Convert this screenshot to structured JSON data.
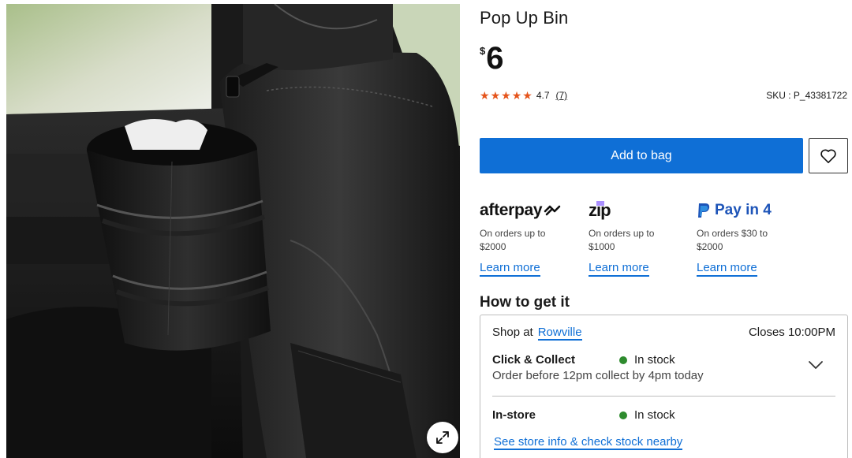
{
  "product": {
    "title": "Pop Up Bin",
    "price_currency": "$",
    "price_amount": "6",
    "rating_value": "4.7",
    "rating_count": "(7)",
    "stars": 4.7,
    "sku": "SKU : P_43381722",
    "image_alt_icon": "expand-icon"
  },
  "actions": {
    "add_to_bag": "Add to bag",
    "wishlist_icon": "heart-icon"
  },
  "payments": [
    {
      "logo": "afterpay",
      "desc": "On orders up to $2000",
      "link": "Learn more"
    },
    {
      "logo": "zip",
      "desc": "On orders up to $1000",
      "link": "Learn more"
    },
    {
      "logo": "Pay in 4",
      "desc": "On orders $30 to $2000",
      "link": "Learn more"
    }
  ],
  "fulfilment": {
    "heading": "How to get it",
    "shop_at_label": "Shop at",
    "store_name": "Rowville",
    "closes": "Closes 10:00PM",
    "click_collect": {
      "label": "Click & Collect",
      "status": "In stock",
      "note": "Order before 12pm collect by 4pm today"
    },
    "in_store": {
      "label": "In-store",
      "status": "In stock"
    },
    "store_link": "See store info & check stock nearby"
  },
  "colors": {
    "primary": "#0f6fd6",
    "star": "#e5541b",
    "in_stock": "#2e8b2e",
    "paypal": "#1d54b8",
    "zip_purple": "#aa8fff"
  }
}
